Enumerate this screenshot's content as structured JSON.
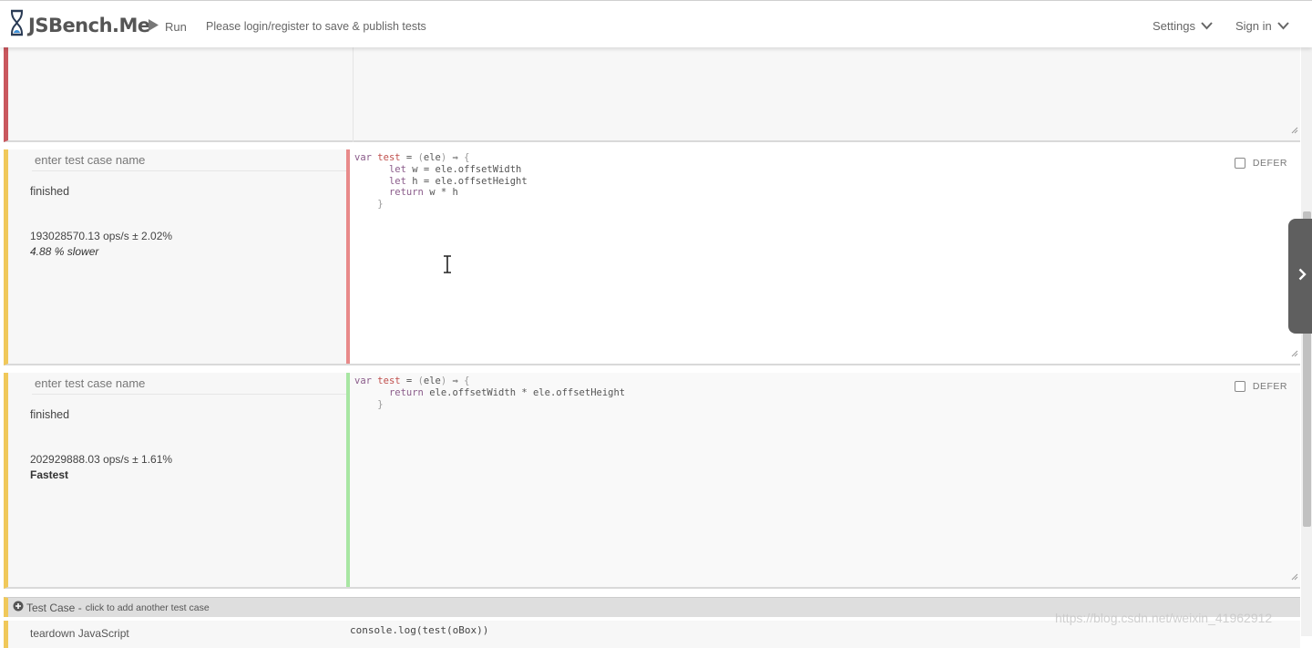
{
  "navbar": {
    "brand": "JSBench.Me",
    "run_label": "Run",
    "login_message": "Please login/register to save & publish tests",
    "settings_label": "Settings",
    "signin_label": "Sign in"
  },
  "cases": [
    {
      "name_placeholder": "enter test case name",
      "status": "finished",
      "ops": "193028570.13 ops/s ± 2.02%",
      "comparison": "4.88 % slower",
      "defer_label": "DEFER",
      "gutter_color": "#e88a8a",
      "code": "var test = (ele) ⇒ {\n      let w = ele.offsetWidth\n      let h = ele.offsetHeight\n      return w * h\n    }"
    },
    {
      "name_placeholder": "enter test case name",
      "status": "finished",
      "ops": "202929888.03 ops/s ± 1.61%",
      "comparison": "Fastest",
      "defer_label": "DEFER",
      "gutter_color": "#a8e6a3",
      "code": "var test = (ele) ⇒ {\n      return ele.offsetWidth * ele.offsetHeight\n    }"
    }
  ],
  "add_case": {
    "label": "Test Case -",
    "hint": "click to add another test case"
  },
  "teardown": {
    "label": "teardown JavaScript",
    "code": "console.log(test(oBox))"
  },
  "watermark": "https://blog.csdn.net/weixin_41962912",
  "colors": {
    "setup_border": "#c9575e",
    "case_border": "#f0c85a"
  },
  "icons": {
    "brand": "hourglass-icon",
    "run": "play-icon",
    "dropdown": "chevron-down-icon",
    "add": "plus-circle-icon",
    "side_tab": "chevron-right-icon",
    "cursor": "text-cursor-icon"
  }
}
